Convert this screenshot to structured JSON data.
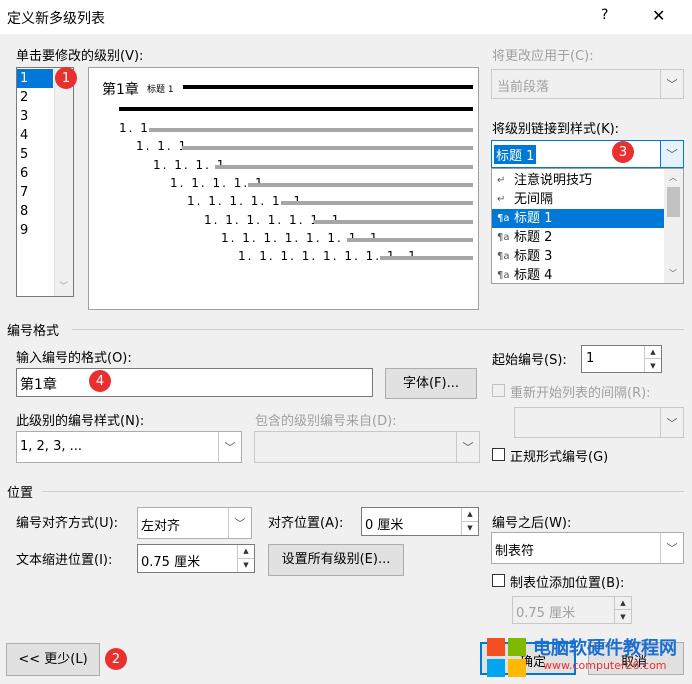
{
  "window": {
    "title": "定义新多级列表",
    "help_label": "?",
    "close_label": "✕"
  },
  "level_section": {
    "label": "单击要修改的级别(V):",
    "levels": [
      "1",
      "2",
      "3",
      "4",
      "5",
      "6",
      "7",
      "8",
      "9"
    ],
    "selected_level": "1"
  },
  "preview": {
    "level1_text": "第1章",
    "level1_style": "标题 1",
    "rows": [
      "1. 1",
      "1. 1. 1",
      "1. 1. 1. 1",
      "1. 1. 1. 1. 1",
      "1. 1. 1. 1. 1. 1",
      "1. 1. 1. 1. 1. 1. 1",
      "1. 1. 1. 1. 1. 1. 1. 1",
      "1. 1. 1. 1. 1. 1. 1. 1. 1"
    ]
  },
  "apply_to": {
    "label": "将更改应用于(C):",
    "value": "当前段落"
  },
  "link_style": {
    "label": "将级别链接到样式(K):",
    "value": "标题 1",
    "options": [
      {
        "icon": "↵",
        "label": "注意说明技巧"
      },
      {
        "icon": "↵",
        "label": "无间隔"
      },
      {
        "icon": "¶a",
        "label": "标题 1"
      },
      {
        "icon": "¶a",
        "label": "标题 2"
      },
      {
        "icon": "¶a",
        "label": "标题 3"
      },
      {
        "icon": "¶a",
        "label": "标题 4"
      }
    ]
  },
  "number_format": {
    "section_title": "编号格式",
    "input_label": "输入编号的格式(O):",
    "input_value": "第1章",
    "font_button": "字体(F)...",
    "style_label": "此级别的编号样式(N):",
    "style_value": "1, 2, 3, ...",
    "include_label": "包含的级别编号来自(D):",
    "include_value": "",
    "start_label": "起始编号(S):",
    "start_value": "1",
    "restart_label": "重新开始列表的间隔(R):",
    "legal_label": "正规形式编号(G)"
  },
  "position": {
    "section_title": "位置",
    "align_label": "编号对齐方式(U):",
    "align_value": "左对齐",
    "align_at_label": "对齐位置(A):",
    "align_at_value": "0 厘米",
    "indent_label": "文本缩进位置(I):",
    "indent_value": "0.75 厘米",
    "set_all_button": "设置所有级别(E)...",
    "follow_label": "编号之后(W):",
    "follow_value": "制表符",
    "tab_add_label": "制表位添加位置(B):",
    "tab_add_value": "0.75 厘米"
  },
  "footer": {
    "less_button": "<< 更少(L)",
    "ok_button": "确定",
    "cancel_button": "取消"
  },
  "badges": [
    "1",
    "2",
    "3",
    "4"
  ],
  "watermark": {
    "title": "电脑软硬件教程网",
    "url": "www.computer26.com"
  },
  "colors": {
    "accent": "#0078d7",
    "badge": "#e8312f",
    "watermark_title": "#1a6fd1",
    "watermark_url": "#e8312f"
  }
}
